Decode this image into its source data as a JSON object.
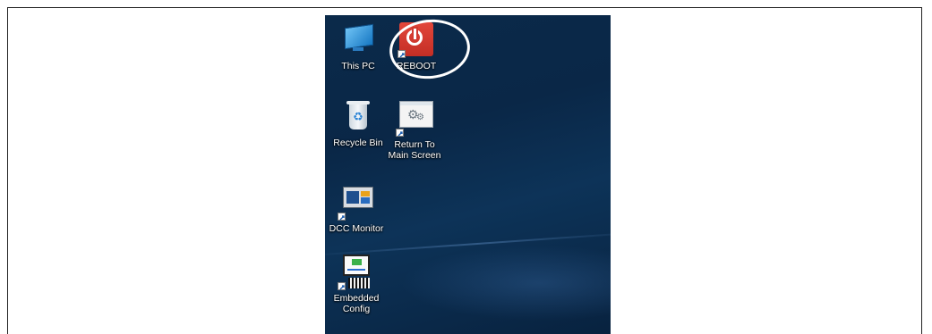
{
  "desktop": {
    "icons": [
      {
        "id": "this-pc",
        "label": "This PC"
      },
      {
        "id": "reboot",
        "label": "REBOOT"
      },
      {
        "id": "recycle-bin",
        "label": "Recycle Bin"
      },
      {
        "id": "return-to-main-screen",
        "label": "Return To Main Screen"
      },
      {
        "id": "dcc-monitor",
        "label": "DCC Monitor"
      },
      {
        "id": "embedded-config",
        "label": "Embedded Config"
      }
    ]
  },
  "colors": {
    "desktop_background": "#0a2747",
    "reboot_accent": "#d13a30",
    "highlight_ring": "#ffffff"
  }
}
